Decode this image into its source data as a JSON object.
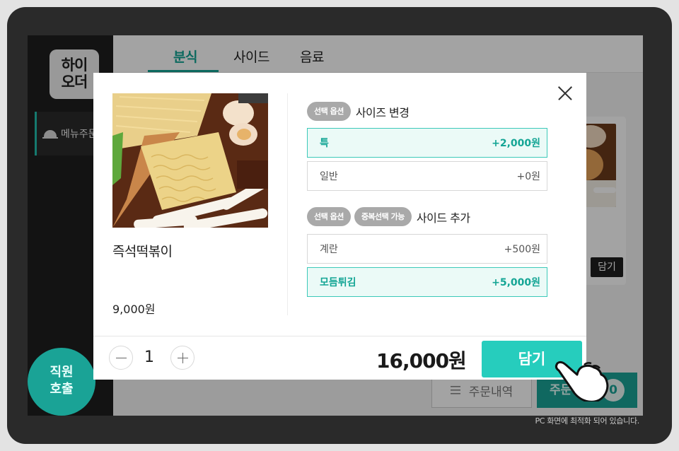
{
  "app": {
    "logo": [
      "하이",
      "오더"
    ],
    "sidebar_item": "메뉴주문",
    "call_staff": [
      "직원",
      "호출"
    ],
    "tabs": [
      "분식",
      "사이드",
      "음료"
    ],
    "active_tab": "분식",
    "bg_add_label": "담기",
    "order_history_label": "주문내역",
    "order_label": "주문",
    "cart_count": "0",
    "pc_note": "PC 화면에 최적화 되어 있습니다."
  },
  "modal": {
    "item_name": "즉석떡볶이",
    "item_price": "9,000원",
    "option_groups": [
      {
        "badges": [
          "선택 옵션"
        ],
        "title": "사이즈 변경",
        "options": [
          {
            "label": "특",
            "price": "+2,000원",
            "selected": true
          },
          {
            "label": "일반",
            "price": "+0원",
            "selected": false
          }
        ]
      },
      {
        "badges": [
          "선택 옵션",
          "중복선택 가능"
        ],
        "title": "사이드 추가",
        "options": [
          {
            "label": "계란",
            "price": "+500원",
            "selected": false
          },
          {
            "label": "모듬튀김",
            "price": "+5,000원",
            "selected": true
          }
        ]
      }
    ],
    "quantity": "1",
    "total": "16,000원",
    "add_label": "담기"
  },
  "colors": {
    "accent": "#26cdbd",
    "accent_dark": "#1aa396",
    "selected_bg": "#ebfaf7"
  }
}
